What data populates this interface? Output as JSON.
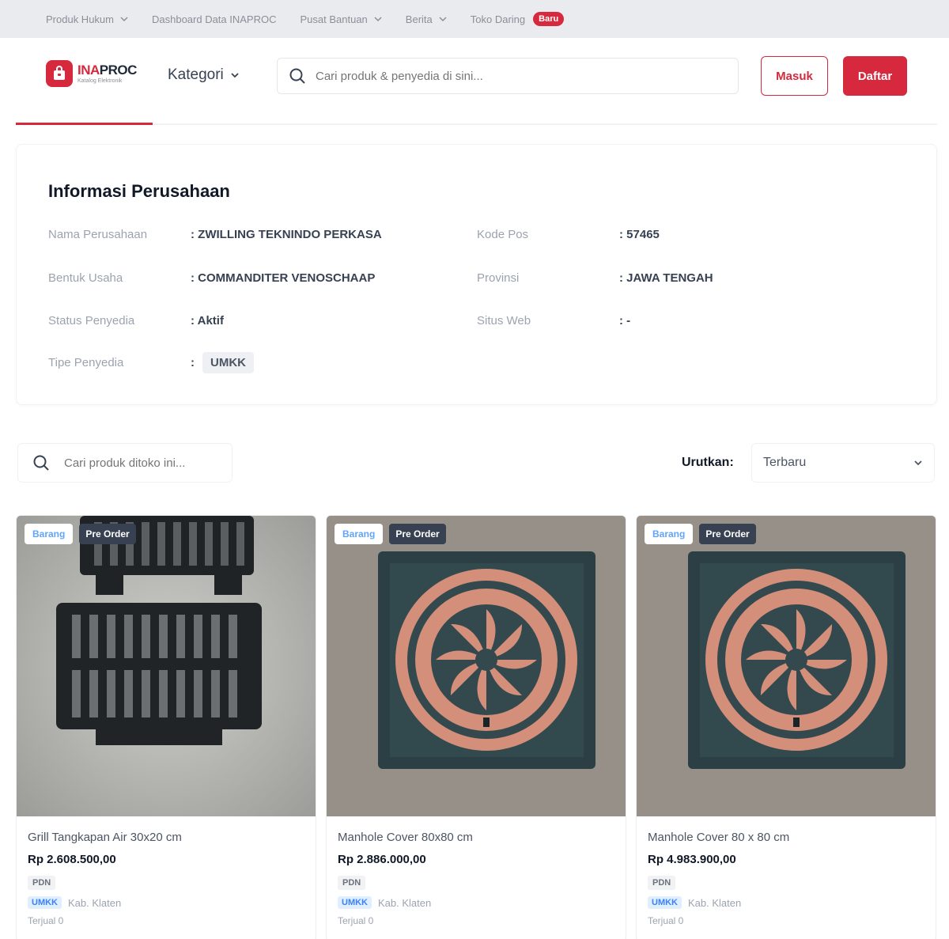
{
  "topbar": {
    "links": [
      {
        "label": "Produk Hukum",
        "has_dropdown": true
      },
      {
        "label": "Dashboard Data INAPROC",
        "has_dropdown": false
      },
      {
        "label": "Pusat Bantuan",
        "has_dropdown": true
      },
      {
        "label": "Berita",
        "has_dropdown": true
      },
      {
        "label": "Toko Daring",
        "has_dropdown": false
      }
    ],
    "new_badge": "Baru"
  },
  "header": {
    "logo_ina": "INA",
    "logo_proc": "PROC",
    "logo_sub": "Katalog Elektronik",
    "kategori_label": "Kategori",
    "search_placeholder": "Cari produk & penyedia di sini...",
    "login_label": "Masuk",
    "register_label": "Daftar"
  },
  "company": {
    "title": "Informasi Perusahaan",
    "fields_left": [
      {
        "label": "Nama Perusahaan",
        "value": ": ZWILLING TEKNINDO PERKASA"
      },
      {
        "label": "Bentuk Usaha",
        "value": ": COMMANDITER VENOSCHAAP"
      },
      {
        "label": "Status Penyedia",
        "value": ": Aktif"
      },
      {
        "label": "Tipe Penyedia",
        "value": ":",
        "tag": "UMKK"
      }
    ],
    "fields_right": [
      {
        "label": "Kode Pos",
        "value": ": 57465"
      },
      {
        "label": "Provinsi",
        "value": ": JAWA TENGAH"
      },
      {
        "label": "Situs Web",
        "value": ": -"
      }
    ]
  },
  "store": {
    "search_placeholder": "Cari produk ditoko ini...",
    "sort_label": "Urutkan:",
    "sort_value": "Terbaru"
  },
  "products": [
    {
      "tag_type": "Barang",
      "tag_order": "Pre Order",
      "name": "Grill Tangkapan Air 30x20 cm",
      "price": "Rp 2.608.500,00",
      "pdn": "PDN",
      "vendor_type": "UMKK",
      "location": "Kab. Klaten",
      "sold": "Terjual 0",
      "image": "drain-grate"
    },
    {
      "tag_type": "Barang",
      "tag_order": "Pre Order",
      "name": "Manhole Cover 80x80 cm",
      "price": "Rp 2.886.000,00",
      "pdn": "PDN",
      "vendor_type": "UMKK",
      "location": "Kab. Klaten",
      "sold": "Terjual 0",
      "image": "manhole-cover"
    },
    {
      "tag_type": "Barang",
      "tag_order": "Pre Order",
      "name": "Manhole Cover 80 x 80 cm",
      "price": "Rp 4.983.900,00",
      "pdn": "PDN",
      "vendor_type": "UMKK",
      "location": "Kab. Klaten",
      "sold": "Terjual 0",
      "image": "manhole-cover"
    }
  ],
  "colors": {
    "brand": "#d6293e",
    "accent_blue": "#3b82f6"
  }
}
